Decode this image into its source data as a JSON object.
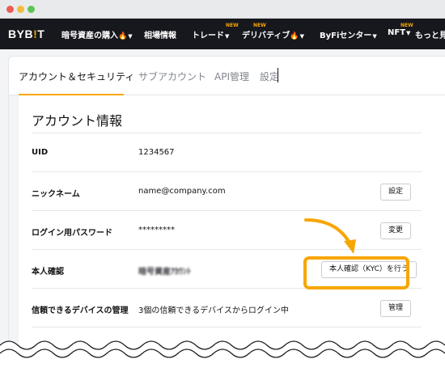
{
  "navbar": {
    "logo_text": "BYB",
    "logo_bar": "!",
    "logo_tail": "T",
    "items": [
      {
        "label": "暗号資産の購入",
        "flame": "🔥",
        "caret": "▼",
        "new": ""
      },
      {
        "label": "相場情報",
        "flame": "",
        "caret": "",
        "new": ""
      },
      {
        "label": "トレード",
        "flame": "",
        "caret": "▼",
        "new": "NEW"
      },
      {
        "label": "デリバティブ",
        "flame": "🔥",
        "caret": "▼",
        "new": "NEW"
      },
      {
        "label": "ByFiセンター",
        "flame": "",
        "caret": "▼",
        "new": ""
      },
      {
        "label": "NFT",
        "flame": "",
        "caret": "▼",
        "new": "NEW"
      },
      {
        "label": "もっと見",
        "flame": "",
        "caret": "",
        "new": ""
      }
    ]
  },
  "tabs": [
    {
      "label": "アカウント＆セキュリティ",
      "active": true
    },
    {
      "label": "サブアカウント",
      "active": false
    },
    {
      "label": "API管理",
      "active": false
    },
    {
      "label": "設定",
      "active": false
    }
  ],
  "section": {
    "title": "アカウント情報",
    "rows": [
      {
        "label": "UID",
        "value": "1234567",
        "button": ""
      },
      {
        "label": "ニックネーム",
        "value": "name@company.com",
        "button": "設定"
      },
      {
        "label": "ログイン用パスワード",
        "value": "*********",
        "button": "変更"
      },
      {
        "label": "本人確認",
        "value": "暗号資産ｱｶｳﾝﾄ",
        "button": "本人確認（KYC）を行う"
      },
      {
        "label": "信頼できるデバイスの管理",
        "value": "3個の信頼できるデバイスからログイン中",
        "button": "管理"
      }
    ]
  },
  "colors": {
    "accent": "#f7a600",
    "navbar_bg": "#17181e",
    "text": "#121214",
    "muted": "#81858c"
  }
}
